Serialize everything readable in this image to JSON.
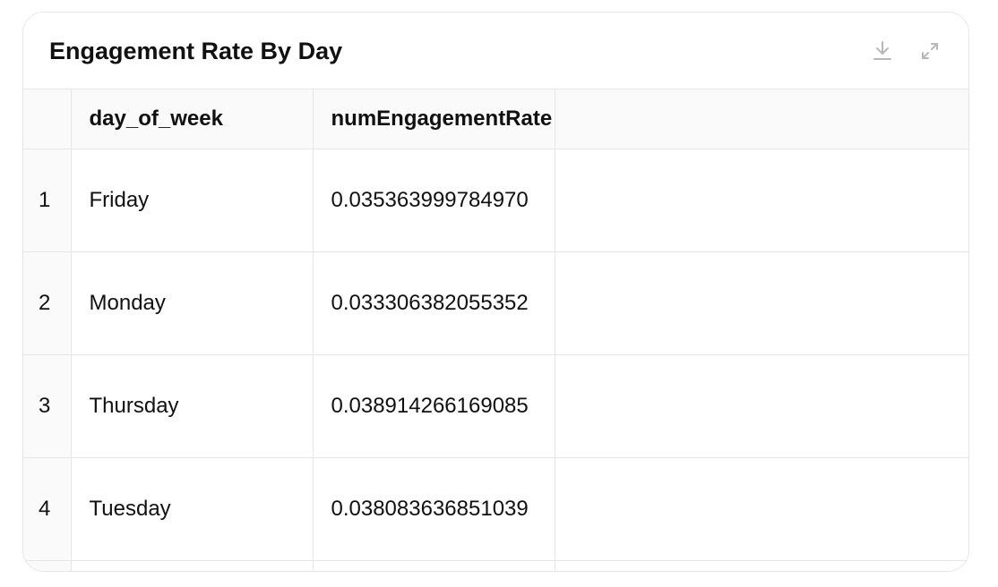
{
  "card": {
    "title": "Engagement Rate By Day",
    "actions": {
      "download_icon": "download-icon",
      "expand_icon": "expand-icon"
    }
  },
  "table": {
    "columns": [
      "",
      "day_of_week",
      "numEngagementRate",
      ""
    ],
    "rows": [
      {
        "index": "1",
        "day_of_week": "Friday",
        "numEngagementRate": "0.035363999784970"
      },
      {
        "index": "2",
        "day_of_week": "Monday",
        "numEngagementRate": "0.033306382055352"
      },
      {
        "index": "3",
        "day_of_week": "Thursday",
        "numEngagementRate": "0.038914266169085"
      },
      {
        "index": "4",
        "day_of_week": "Tuesday",
        "numEngagementRate": "0.038083636851039"
      }
    ]
  },
  "colors": {
    "border": "#e6e6e6",
    "header_bg": "#fafafa",
    "icon": "#b8b8b8",
    "text": "#111111"
  }
}
